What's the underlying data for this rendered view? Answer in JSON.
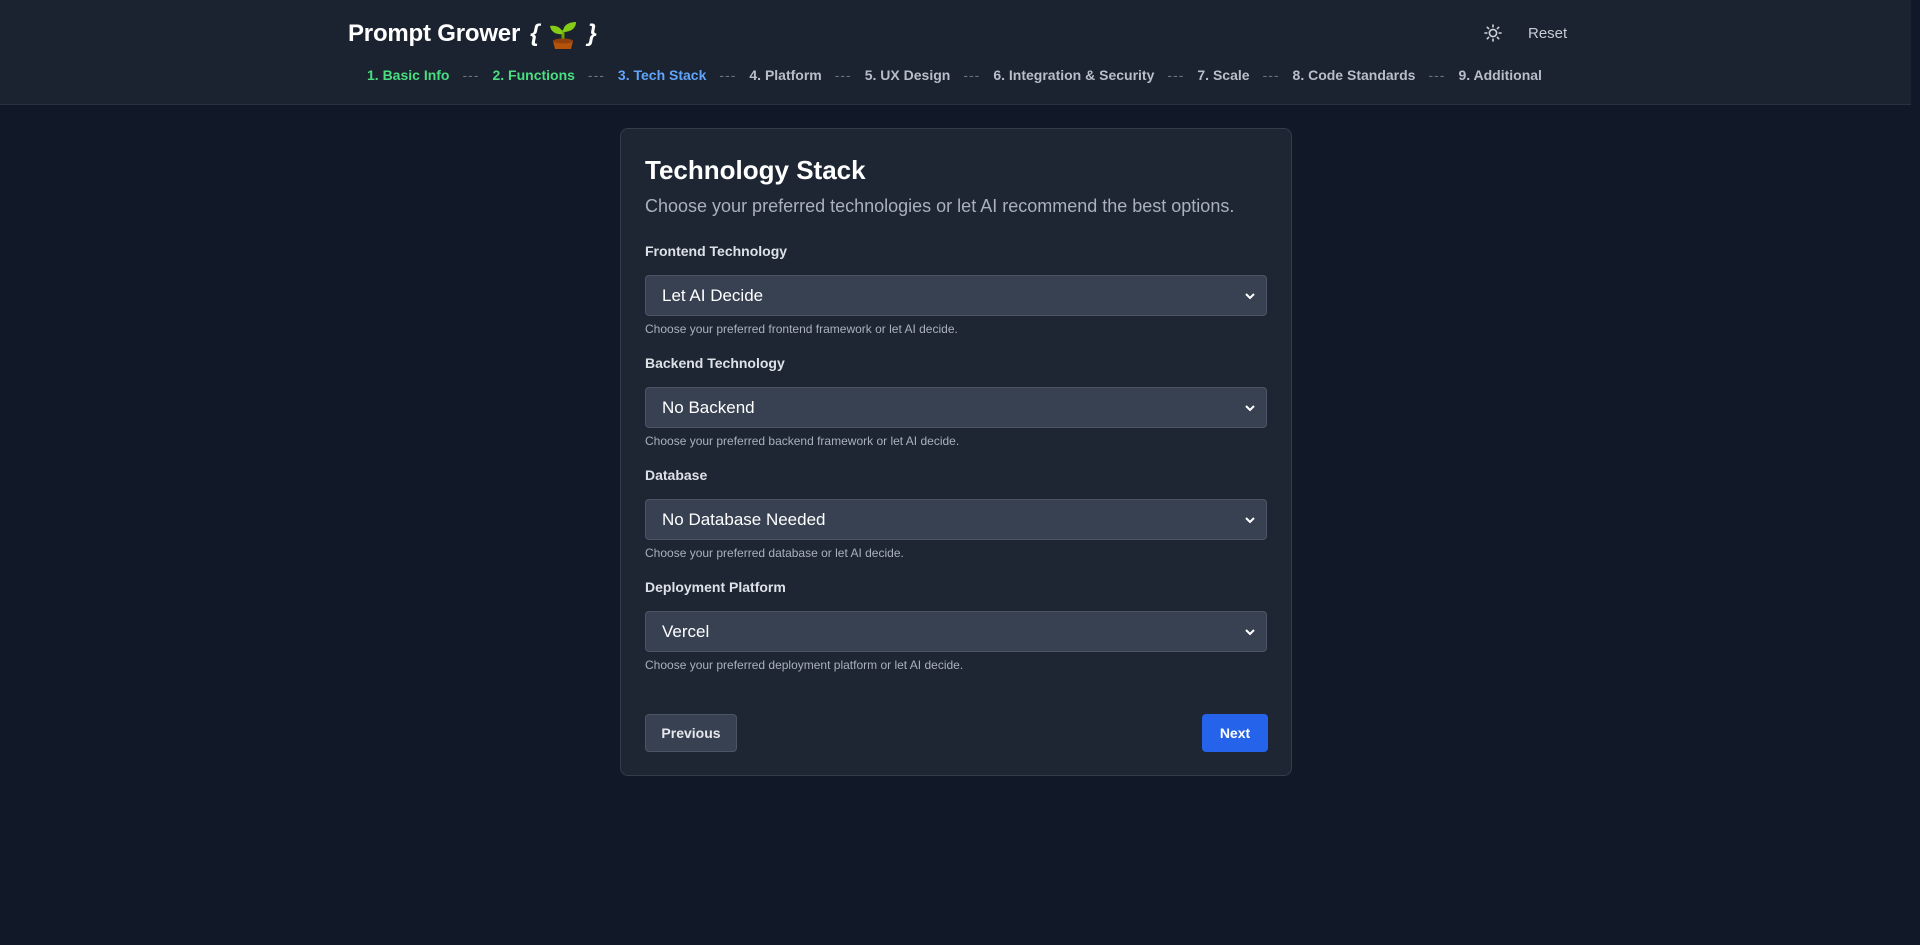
{
  "header": {
    "brand": "Prompt Grower",
    "brace_open": "{",
    "brace_close": "}",
    "logo_icon": "sprout-icon",
    "theme_icon": "sun-icon",
    "reset_label": "Reset"
  },
  "steps": [
    {
      "label": "1. Basic Info",
      "state": "done"
    },
    {
      "label": "2. Functions",
      "state": "done"
    },
    {
      "label": "3. Tech Stack",
      "state": "active"
    },
    {
      "label": "4. Platform",
      "state": "pending"
    },
    {
      "label": "5. UX Design",
      "state": "pending"
    },
    {
      "label": "6. Integration & Security",
      "state": "pending"
    },
    {
      "label": "7. Scale",
      "state": "pending"
    },
    {
      "label": "8. Code Standards",
      "state": "pending"
    },
    {
      "label": "9. Additional",
      "state": "pending"
    }
  ],
  "step_separator": "---",
  "card": {
    "title": "Technology Stack",
    "subtitle": "Choose your preferred technologies or let AI recommend the best options."
  },
  "fields": [
    {
      "label": "Frontend Technology",
      "value": "Let AI Decide",
      "hint": "Choose your preferred frontend framework or let AI decide."
    },
    {
      "label": "Backend Technology",
      "value": "No Backend",
      "hint": "Choose your preferred backend framework or let AI decide."
    },
    {
      "label": "Database",
      "value": "No Database Needed",
      "hint": "Choose your preferred database or let AI decide."
    },
    {
      "label": "Deployment Platform",
      "value": "Vercel",
      "hint": "Choose your preferred deployment platform or let AI decide."
    }
  ],
  "buttons": {
    "previous": "Previous",
    "next": "Next"
  },
  "colors": {
    "background": "#111827",
    "card": "#1e2533",
    "step_done": "#4ade80",
    "step_active": "#60a5fa",
    "primary": "#2563eb"
  }
}
